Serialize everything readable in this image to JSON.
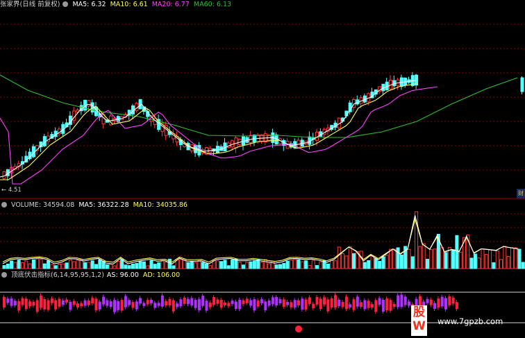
{
  "main_legend": {
    "title": "张家界(日线 前复权)",
    "ma5": "MA5: 6.32",
    "ma10": "MA10: 6.61",
    "ma20": "MA20: 6.77",
    "ma60": "MA60: 6.13"
  },
  "volume_legend": {
    "title": "VOLUME: 34594.08",
    "ma5": "MA5: 36322.28",
    "ma10": "MA10: 34035.86"
  },
  "indicator_legend": {
    "title": "顶底伏击指标(6,14,95,95,1,2)",
    "as": "AS: 96.00",
    "ad": "AD: 106.00"
  },
  "low_marker": "4.51",
  "side_tab": "财",
  "watermark": {
    "logo": "股W",
    "url": "www.7gpzb.com"
  },
  "colors": {
    "up": "#ff3838",
    "down": "#54ffff",
    "ma5": "#ffffff",
    "ma10": "#ffff50",
    "ma20": "#ff40ff",
    "ma60": "#30c030",
    "indicator_purple": "#b030ff",
    "indicator_red": "#ff2040",
    "grid": "#8a0000"
  }
}
